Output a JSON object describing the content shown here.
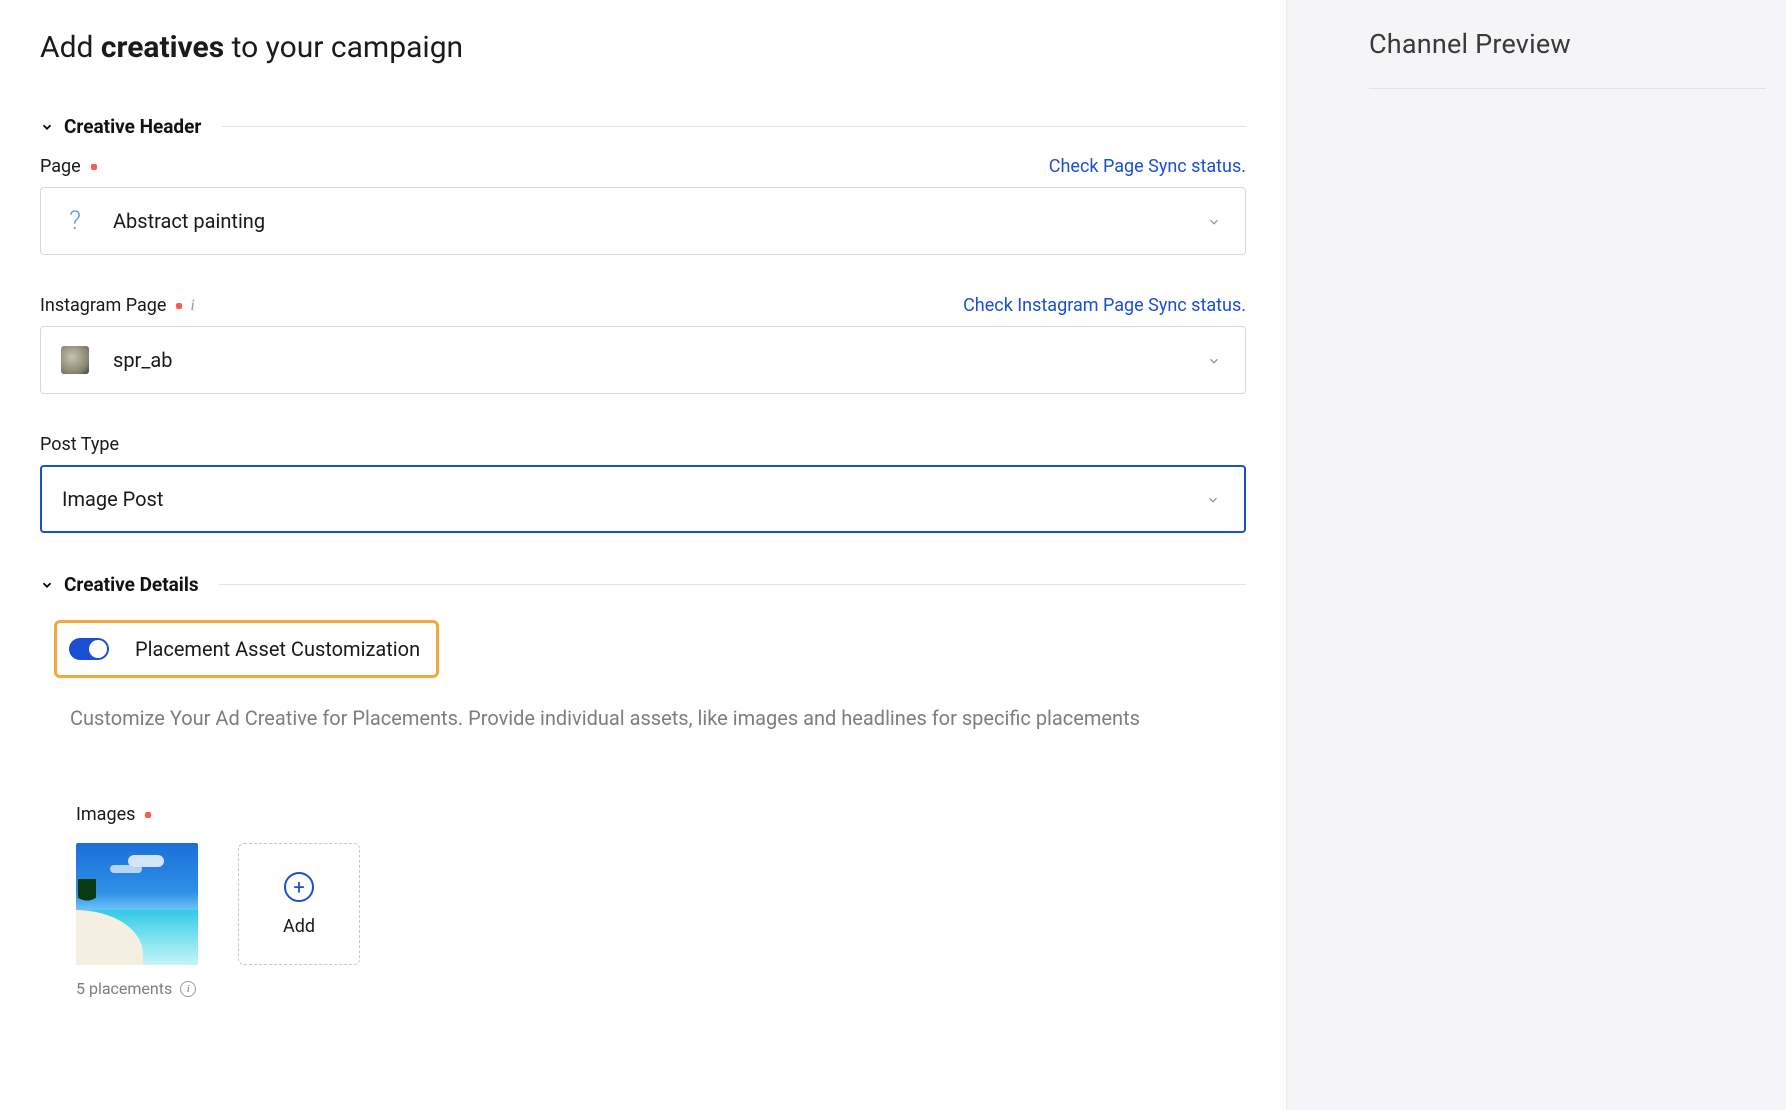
{
  "page_title_prefix": "Add ",
  "page_title_bold": "creatives",
  "page_title_suffix": " to your campaign",
  "section1": {
    "title": "Creative Header",
    "page_label": "Page",
    "page_sync_link": "Check Page Sync status.",
    "page_value": "Abstract painting",
    "instagram_label": "Instagram Page",
    "instagram_sync_link": "Check Instagram Page Sync status.",
    "instagram_value": "spr_ab",
    "post_type_label": "Post Type",
    "post_type_value": "Image Post"
  },
  "section2": {
    "title": "Creative Details",
    "toggle_label": "Placement Asset Customization",
    "toggle_on": true,
    "description": "Customize Your Ad Creative for Placements. Provide individual assets, like images and headlines for specific placements",
    "images_label": "Images",
    "placements_text": "5 placements",
    "add_label": "Add"
  },
  "side": {
    "title": "Channel Preview"
  }
}
